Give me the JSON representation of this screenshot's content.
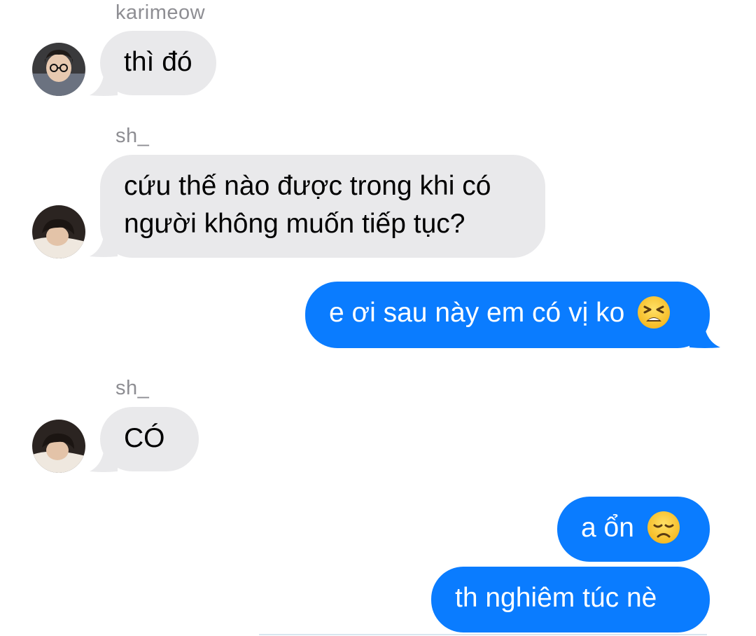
{
  "conversation": {
    "messages": [
      {
        "sender": "karimeow",
        "direction": "incoming",
        "text": "thì đó"
      },
      {
        "sender": "sh_",
        "direction": "incoming",
        "lines": [
          "cứu thế nào được trong khi có",
          "người không muốn tiếp tục?"
        ]
      },
      {
        "direction": "outgoing",
        "text": "e ơi sau này em có vị ko",
        "emoji": "tired-face-emoji"
      },
      {
        "sender": "sh_",
        "direction": "incoming",
        "text": "CÓ"
      },
      {
        "direction": "outgoing",
        "text": "a ổn",
        "emoji": "disappointed-face-emoji"
      },
      {
        "direction": "outgoing",
        "text": "th nghiêm túc nè"
      }
    ]
  },
  "colors": {
    "incoming_bubble": "#e9e9eb",
    "outgoing_bubble": "#0a7cff",
    "sender_name": "#8e8e93"
  }
}
